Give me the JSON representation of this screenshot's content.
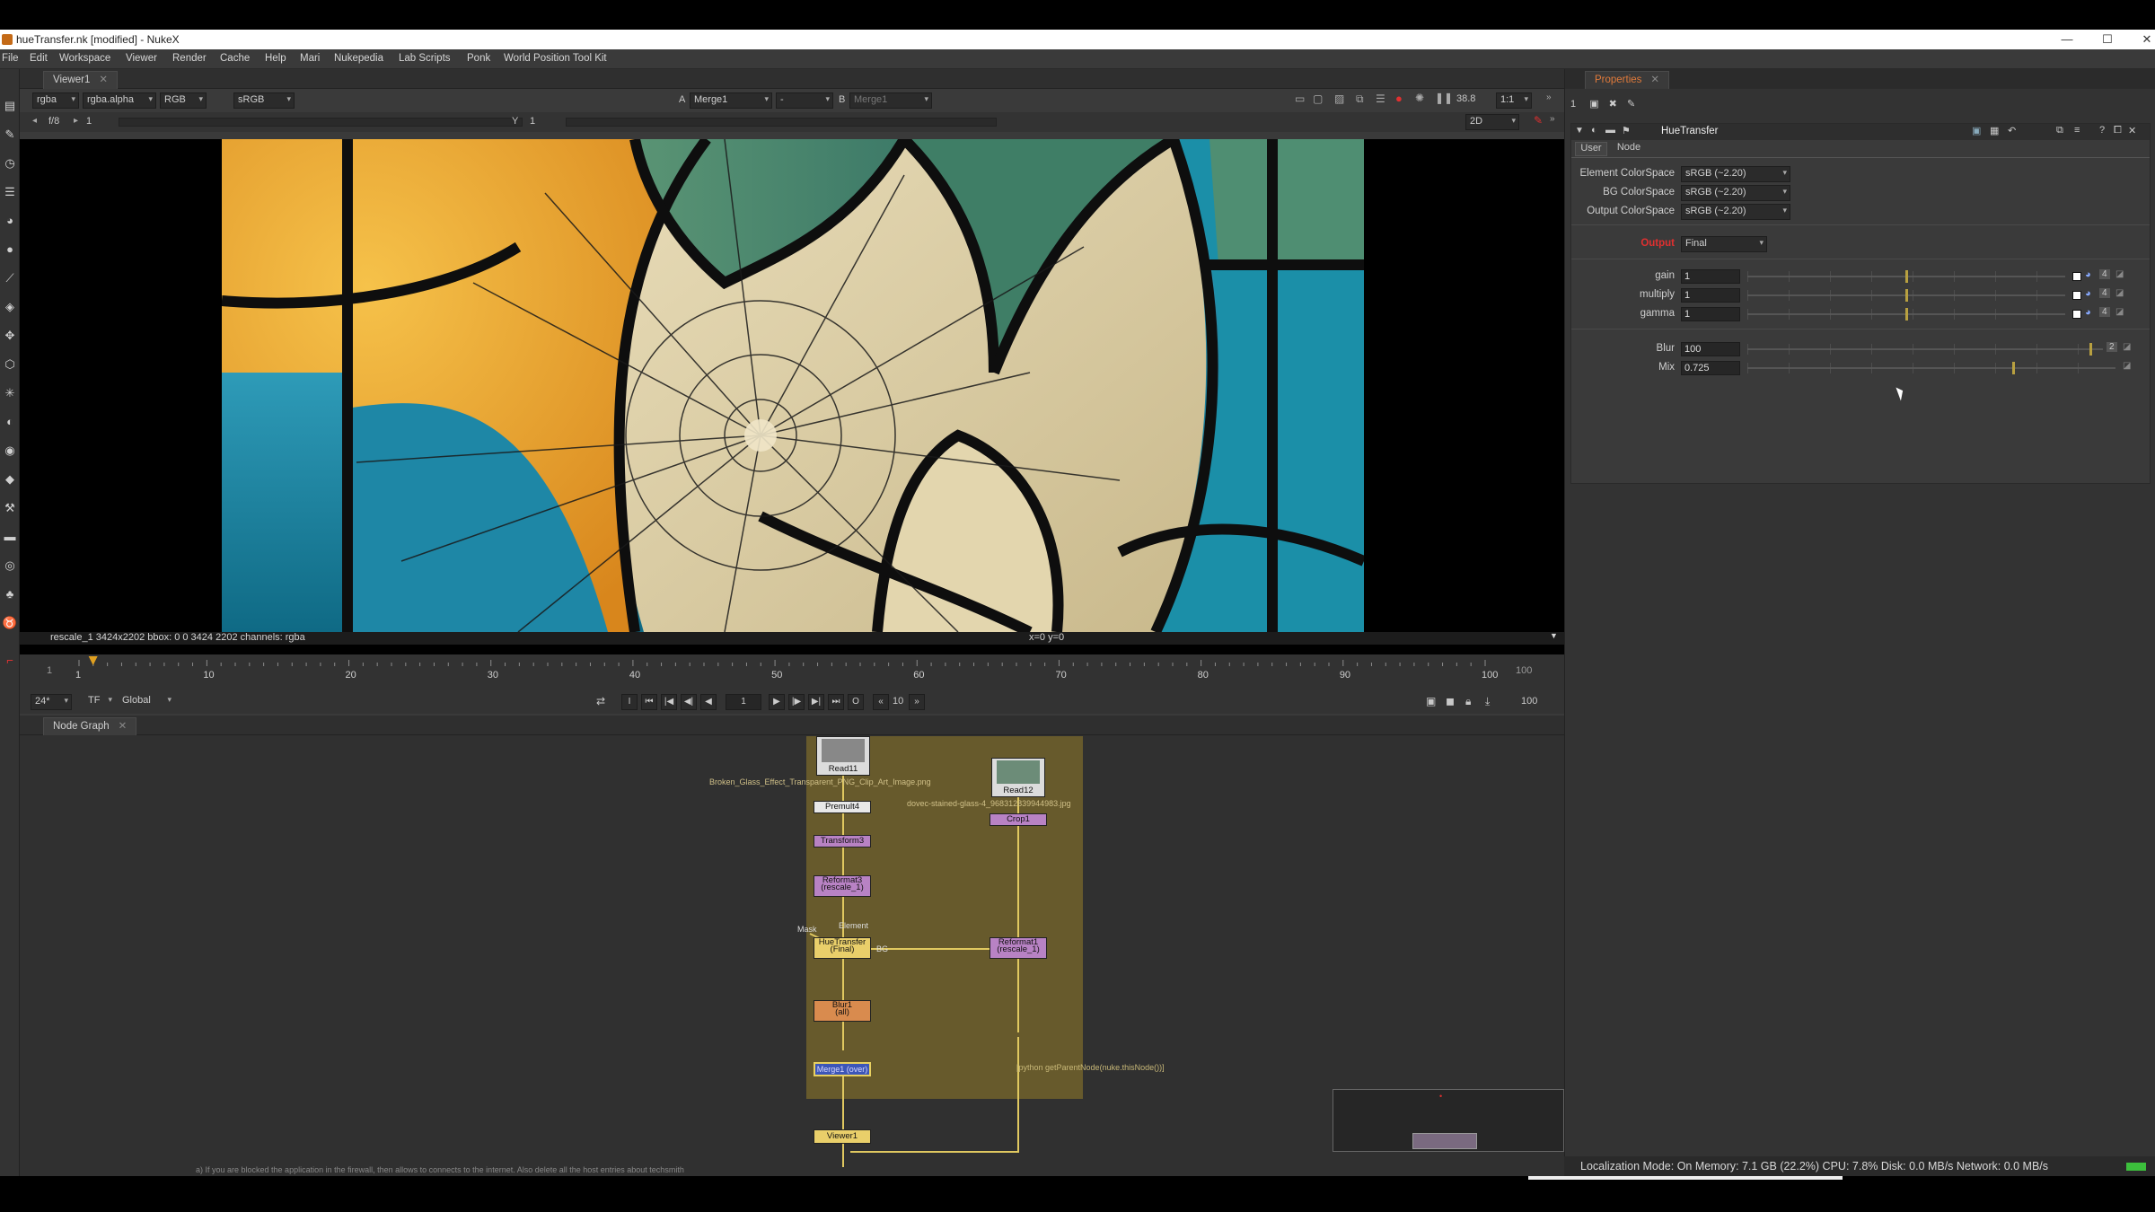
{
  "window": {
    "title": "hueTransfer.nk [modified] - NukeX",
    "min": "—",
    "max": "☐",
    "close": "✕"
  },
  "menu": [
    "File",
    "Edit",
    "Workspace",
    "Viewer",
    "Render",
    "Cache",
    "Help",
    "Mari",
    "Nukepedia",
    "Lab Scripts",
    "Ponk",
    "World Position Tool Kit"
  ],
  "viewer": {
    "tab": "Viewer1",
    "channels": "rgba",
    "alpha": "rgba.alpha",
    "display": "RGB",
    "lut": "sRGB",
    "a_label": "A",
    "a_input": "Merge1",
    "wipe": "-",
    "b_label": "B",
    "b_input": "Merge1",
    "exposure": "38.8",
    "zoom": "1:1",
    "frame_label": "f/8",
    "frame_val": "1",
    "y_label": "Y",
    "y_val": "1",
    "mode": "2D",
    "info_left": "rescale_1 3424x2202  bbox: 0 0 3424 2202 channels: rgba",
    "info_center": "x=0 y=0"
  },
  "timeline": {
    "start": "1",
    "end": "100",
    "ticks": [
      "1",
      "10",
      "20",
      "30",
      "40",
      "50",
      "60",
      "70",
      "80",
      "90",
      "100"
    ],
    "current": 0.01,
    "fps": "24*",
    "tf": "TF",
    "global": "Global",
    "frame": "1",
    "step": "10",
    "end_frame": "100"
  },
  "nodegraph": {
    "tab": "Node Graph",
    "nodes": {
      "read11": "Read11",
      "read11_file": "Broken_Glass_Effect_Transparent_PNG_Clip_Art_Image.png",
      "read12": "Read12",
      "read12_file": "dovec-stained-glass-4_968312839944983.jpg",
      "premult": "Premult4",
      "transform": "Transform3",
      "reformat3": "Reformat3\n(rescale_1)",
      "crop": "Crop1",
      "huetransfer": "HueTransfer\n(Final)",
      "reformat1": "Reformat1\n(rescale_1)",
      "blur": "Blur1\n(all)",
      "merge": "Merge1 (over)",
      "viewer": "Viewer1",
      "element_label": "Element",
      "mask_label": "Mask",
      "bg_label": "BG",
      "expr": "[python getParentNode(nuke.thisNode())]"
    },
    "footer_note": "a) If you are blocked the application in the firewall, then allows to connects to the internet. Also delete all the host entries about techsmith"
  },
  "properties": {
    "tab": "Properties",
    "node_name": "HueTransfer",
    "tab_user": "User",
    "tab_node": "Node",
    "fields": [
      {
        "label": "Element ColorSpace",
        "value": "sRGB (~2.20)"
      },
      {
        "label": "BG ColorSpace",
        "value": "sRGB (~2.20)"
      },
      {
        "label": "Output ColorSpace",
        "value": "sRGB (~2.20)"
      }
    ],
    "output_label": "Output",
    "output_value": "Final",
    "sliders": [
      {
        "label": "gain",
        "value": "1",
        "level": 0.5,
        "scale": [
          "0",
          "0.2",
          "0.5",
          "0.7",
          "1",
          "2",
          "3",
          "4"
        ]
      },
      {
        "label": "multiply",
        "value": "1",
        "level": 0.5,
        "scale": [
          "0",
          "0.2",
          "0.5",
          "0.7",
          "1",
          "2",
          "3",
          "4"
        ]
      },
      {
        "label": "gamma",
        "value": "1",
        "level": 0.5,
        "scale": [
          "0.2",
          "0.5",
          "0.7",
          "0.9",
          "1",
          "2",
          "3",
          "4"
        ]
      },
      {
        "label": "Blur",
        "value": "100",
        "level": 0.97,
        "scale": [
          "0",
          "1",
          "5",
          "10",
          "20",
          "30",
          "40",
          "50",
          "60",
          "70",
          "80",
          "90",
          "100"
        ]
      },
      {
        "label": "Mix",
        "value": "0.725",
        "level": 0.725,
        "scale": [
          "0",
          "0.1",
          "0.2",
          "0.3",
          "0.4",
          "0.5",
          "0.6",
          "0.7",
          "0.8",
          "0.9",
          "1"
        ]
      }
    ],
    "swatch_num": "4",
    "blur_num": "2"
  },
  "status": {
    "text": "Localization Mode: On Memory: 7.1 GB (22.2%) CPU: 7.8% Disk: 0.0 MB/s Network: 0.0 MB/s"
  },
  "colors": {
    "accent_red": "#e03030",
    "panel": "#3a3a3a",
    "backdrop": "#6a5d2c"
  }
}
